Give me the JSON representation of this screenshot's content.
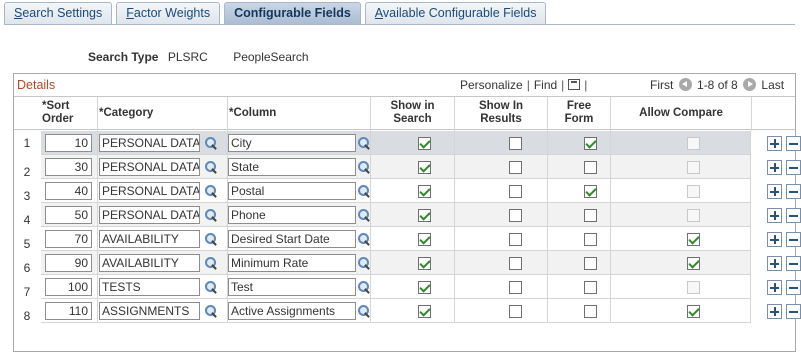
{
  "tabs": [
    {
      "label": "Search Settings",
      "accel_index": 0
    },
    {
      "label": "Factor Weights",
      "accel_index": 0
    },
    {
      "label": "Configurable Fields",
      "accel_index": -1
    },
    {
      "label": "Available Configurable Fields",
      "accel_index": 0
    }
  ],
  "active_tab": 2,
  "search_type": {
    "label": "Search Type",
    "code": "PLSRC",
    "description": "PeopleSearch"
  },
  "grid": {
    "title": "Details",
    "personalize": "Personalize",
    "find": "Find",
    "pager_first": "First",
    "pager_range": "1-8 of 8",
    "pager_last": "Last",
    "columns": {
      "sort_order": [
        "*Sort",
        "Order"
      ],
      "category": "*Category",
      "column": "*Column",
      "show_in_search": [
        "Show in",
        "Search"
      ],
      "show_in_results": [
        "Show In",
        "Results"
      ],
      "free_form": [
        "Free",
        "Form"
      ],
      "allow_compare": "Allow Compare"
    },
    "rows": [
      {
        "num": "1",
        "sort": "10",
        "category": "PERSONAL DATA",
        "column": "City",
        "show_in_search": true,
        "show_in_results": false,
        "free_form": true,
        "allow_compare": false,
        "allow_compare_enabled": false
      },
      {
        "num": "2",
        "sort": "30",
        "category": "PERSONAL DATA",
        "column": "State",
        "show_in_search": true,
        "show_in_results": false,
        "free_form": false,
        "allow_compare": false,
        "allow_compare_enabled": false
      },
      {
        "num": "3",
        "sort": "40",
        "category": "PERSONAL DATA",
        "column": "Postal",
        "show_in_search": true,
        "show_in_results": false,
        "free_form": true,
        "allow_compare": false,
        "allow_compare_enabled": false
      },
      {
        "num": "4",
        "sort": "50",
        "category": "PERSONAL DATA",
        "column": "Phone",
        "show_in_search": true,
        "show_in_results": false,
        "free_form": false,
        "allow_compare": false,
        "allow_compare_enabled": false
      },
      {
        "num": "5",
        "sort": "70",
        "category": "AVAILABILITY",
        "column": "Desired Start Date",
        "show_in_search": true,
        "show_in_results": false,
        "free_form": false,
        "allow_compare": true,
        "allow_compare_enabled": true
      },
      {
        "num": "6",
        "sort": "90",
        "category": "AVAILABILITY",
        "column": "Minimum Rate",
        "show_in_search": true,
        "show_in_results": false,
        "free_form": false,
        "allow_compare": true,
        "allow_compare_enabled": true
      },
      {
        "num": "7",
        "sort": "100",
        "category": "TESTS",
        "column": "Test",
        "show_in_search": true,
        "show_in_results": false,
        "free_form": false,
        "allow_compare": false,
        "allow_compare_enabled": false
      },
      {
        "num": "8",
        "sort": "110",
        "category": "ASSIGNMENTS",
        "column": "Active Assignments",
        "show_in_search": true,
        "show_in_results": false,
        "free_form": false,
        "allow_compare": true,
        "allow_compare_enabled": true
      }
    ]
  },
  "colors": {
    "title": "#b24a25",
    "check": "#2f8a2a",
    "selected_row": "#d9dde2"
  }
}
